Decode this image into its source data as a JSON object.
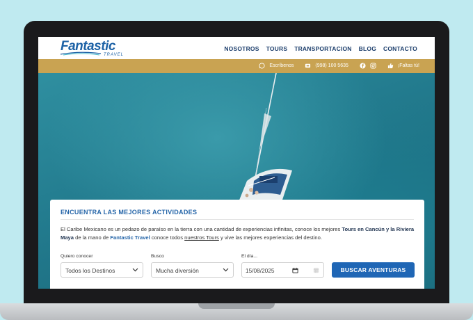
{
  "colors": {
    "background": "#bfeaf0",
    "brand_blue": "#1d62a6",
    "nav_text": "#1b3d6b",
    "contact_bar": "#c9a352",
    "button": "#1f66b5"
  },
  "logo": {
    "name": "Fantastic",
    "sub": "TRAVEL"
  },
  "nav": {
    "items": [
      "NOSOTROS",
      "TOURS",
      "TRANSPORTACION",
      "BLOG",
      "CONTACTO"
    ]
  },
  "contact_bar": {
    "whatsapp_icon": "whatsapp-icon",
    "whatsapp_label": "Escríbenos",
    "phone_icon": "phone-icon",
    "phone": "(998) 100 5635",
    "facebook_icon": "facebook-icon",
    "instagram_icon": "instagram-icon",
    "like_icon": "thumbs-up-icon",
    "like_label": "¡Faltas tú!"
  },
  "search_panel": {
    "title": "ENCUENTRA LAS MEJORES ACTIVIDADES",
    "text_1": "El Caribe Mexicano es un pedazo de paraíso en la tierra con una cantidad de experiencias infinitas, conoce los mejores ",
    "text_bold_1": "Tours en Cancún y la Riviera Maya",
    "text_2": " de la mano de ",
    "text_brand": "Fantastic Travel",
    "text_3": " conoce todos ",
    "text_link": "nuestros Tours",
    "text_4": " y vive las mejores experiencias del destino.",
    "destination_label": "Quiero conocer",
    "destination_value": "Todos los Destinos",
    "type_label": "Busco",
    "type_value": "Mucha diversión",
    "date_label": "El día...",
    "date_value": "15/08/2025",
    "button_label": "BUSCAR AVENTURAS"
  }
}
